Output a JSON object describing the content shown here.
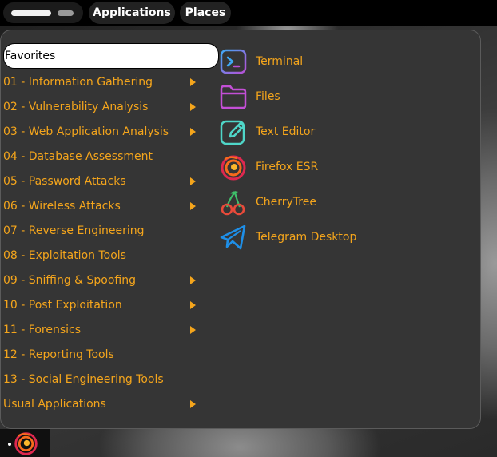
{
  "topbar": {
    "applications_label": "Applications",
    "places_label": "Places"
  },
  "menu": {
    "search_value": "Favorites",
    "categories": [
      {
        "label": "01 - Information Gathering",
        "submenu": true
      },
      {
        "label": "02 - Vulnerability Analysis",
        "submenu": true
      },
      {
        "label": "03 - Web Application Analysis",
        "submenu": true
      },
      {
        "label": "04 - Database Assessment",
        "submenu": false
      },
      {
        "label": "05 - Password Attacks",
        "submenu": true
      },
      {
        "label": "06 - Wireless Attacks",
        "submenu": true
      },
      {
        "label": "07 - Reverse Engineering",
        "submenu": false
      },
      {
        "label": "08 - Exploitation Tools",
        "submenu": false
      },
      {
        "label": "09 - Sniffing & Spoofing",
        "submenu": true
      },
      {
        "label": "10 - Post Exploitation",
        "submenu": true
      },
      {
        "label": "11 - Forensics",
        "submenu": true
      },
      {
        "label": "12 - Reporting Tools",
        "submenu": false
      },
      {
        "label": "13 - Social Engineering Tools",
        "submenu": false
      },
      {
        "label": "Usual Applications",
        "submenu": true
      }
    ],
    "apps": [
      {
        "label": "Terminal",
        "icon": "terminal-icon"
      },
      {
        "label": "Files",
        "icon": "folder-icon"
      },
      {
        "label": "Text Editor",
        "icon": "text-editor-icon"
      },
      {
        "label": "Firefox ESR",
        "icon": "firefox-icon"
      },
      {
        "label": "CherryTree",
        "icon": "cherrytree-icon"
      },
      {
        "label": "Telegram Desktop",
        "icon": "telegram-icon"
      }
    ]
  },
  "dock": {
    "running_app_icon": "firefox-icon"
  },
  "colors": {
    "accent": "#f4a51c",
    "menu_bg": "#353535",
    "topbar_bg": "#000000"
  }
}
